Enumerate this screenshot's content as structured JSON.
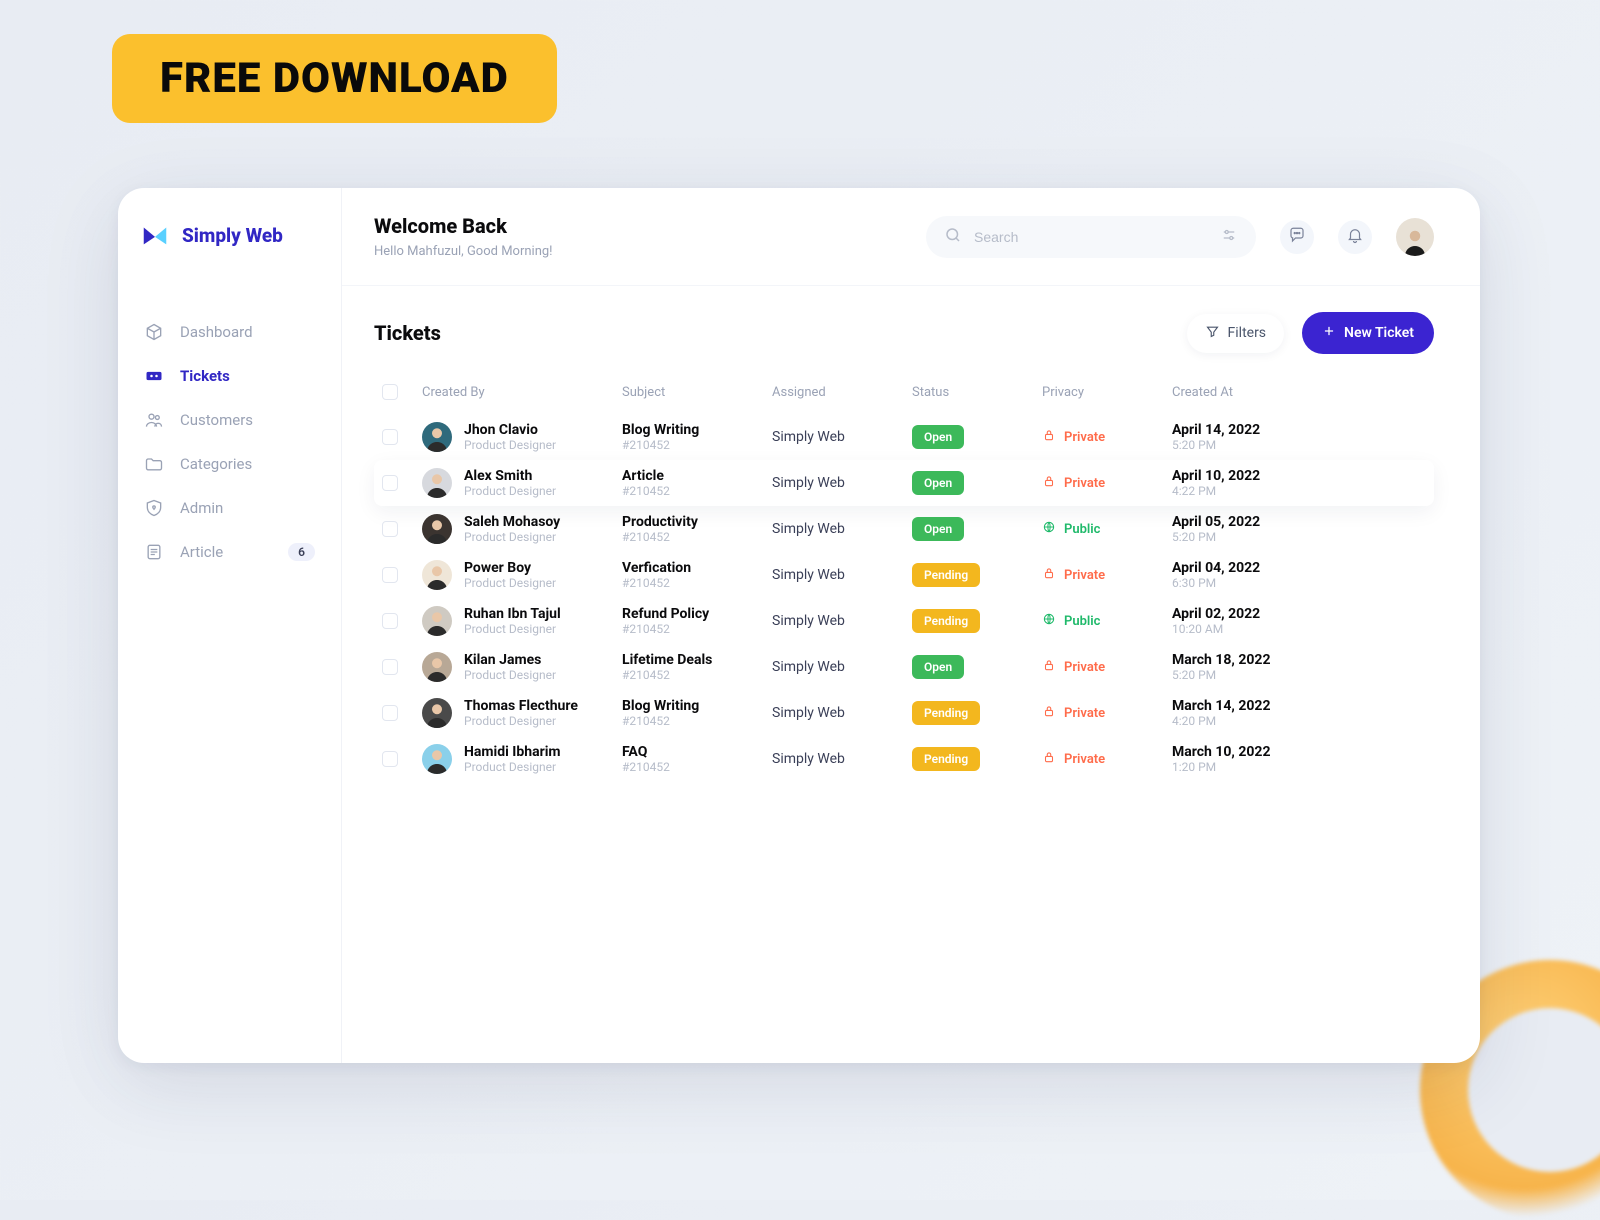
{
  "banner": "FREE DOWNLOAD",
  "brand": {
    "name": "Simply Web"
  },
  "sidebar": {
    "items": [
      {
        "label": "Dashboard"
      },
      {
        "label": "Tickets"
      },
      {
        "label": "Customers"
      },
      {
        "label": "Categories"
      },
      {
        "label": "Admin"
      },
      {
        "label": "Article",
        "badge": "6"
      }
    ]
  },
  "header": {
    "title": "Welcome Back",
    "subtitle": "Hello Mahfuzul, Good Morning!",
    "search_placeholder": "Search"
  },
  "page": {
    "title": "Tickets",
    "filters_label": "Filters",
    "new_label": "New Ticket"
  },
  "columns": {
    "created_by": "Created By",
    "subject": "Subject",
    "assigned": "Assigned",
    "status": "Status",
    "privacy": "Privacy",
    "created_at": "Created At"
  },
  "rows": [
    {
      "name": "Jhon Clavio",
      "role": "Product Designer",
      "subject": "Blog Writing",
      "ticket": "#210452",
      "assigned": "Simply Web",
      "status": "Open",
      "privacy": "Private",
      "date": "April 14, 2022",
      "time": "5:20 PM",
      "avatar_bg": "#2f6a7c"
    },
    {
      "name": "Alex Smith",
      "role": "Product Designer",
      "subject": "Article",
      "ticket": "#210452",
      "assigned": "Simply Web",
      "status": "Open",
      "privacy": "Private",
      "date": "April 10, 2022",
      "time": "4:22 PM",
      "avatar_bg": "#d7d9de"
    },
    {
      "name": "Saleh Mohasoy",
      "role": "Product Designer",
      "subject": "Productivity",
      "ticket": "#210452",
      "assigned": "Simply Web",
      "status": "Open",
      "privacy": "Public",
      "date": "April 05, 2022",
      "time": "5:20 PM",
      "avatar_bg": "#3b3430"
    },
    {
      "name": "Power Boy",
      "role": "Product Designer",
      "subject": "Verfication",
      "ticket": "#210452",
      "assigned": "Simply Web",
      "status": "Pending",
      "privacy": "Private",
      "date": "April 04, 2022",
      "time": "6:30 PM",
      "avatar_bg": "#efe6d8"
    },
    {
      "name": "Ruhan Ibn Tajul",
      "role": "Product Designer",
      "subject": "Refund Policy",
      "ticket": "#210452",
      "assigned": "Simply Web",
      "status": "Pending",
      "privacy": "Public",
      "date": "April 02, 2022",
      "time": "10:20 AM",
      "avatar_bg": "#cfcac2"
    },
    {
      "name": "Kilan James",
      "role": "Product Designer",
      "subject": "Lifetime Deals",
      "ticket": "#210452",
      "assigned": "Simply Web",
      "status": "Open",
      "privacy": "Private",
      "date": "March 18, 2022",
      "time": "5:20 PM",
      "avatar_bg": "#b8a896"
    },
    {
      "name": "Thomas Flecthure",
      "role": "Product Designer",
      "subject": "Blog Writing",
      "ticket": "#210452",
      "assigned": "Simply Web",
      "status": "Pending",
      "privacy": "Private",
      "date": "March 14, 2022",
      "time": "4:20 PM",
      "avatar_bg": "#4a4a4a"
    },
    {
      "name": "Hamidi Ibharim",
      "role": "Product Designer",
      "subject": "FAQ",
      "ticket": "#210452",
      "assigned": "Simply Web",
      "status": "Pending",
      "privacy": "Private",
      "date": "March 10, 2022",
      "time": "1:20 PM",
      "avatar_bg": "#8ad0ea"
    }
  ]
}
